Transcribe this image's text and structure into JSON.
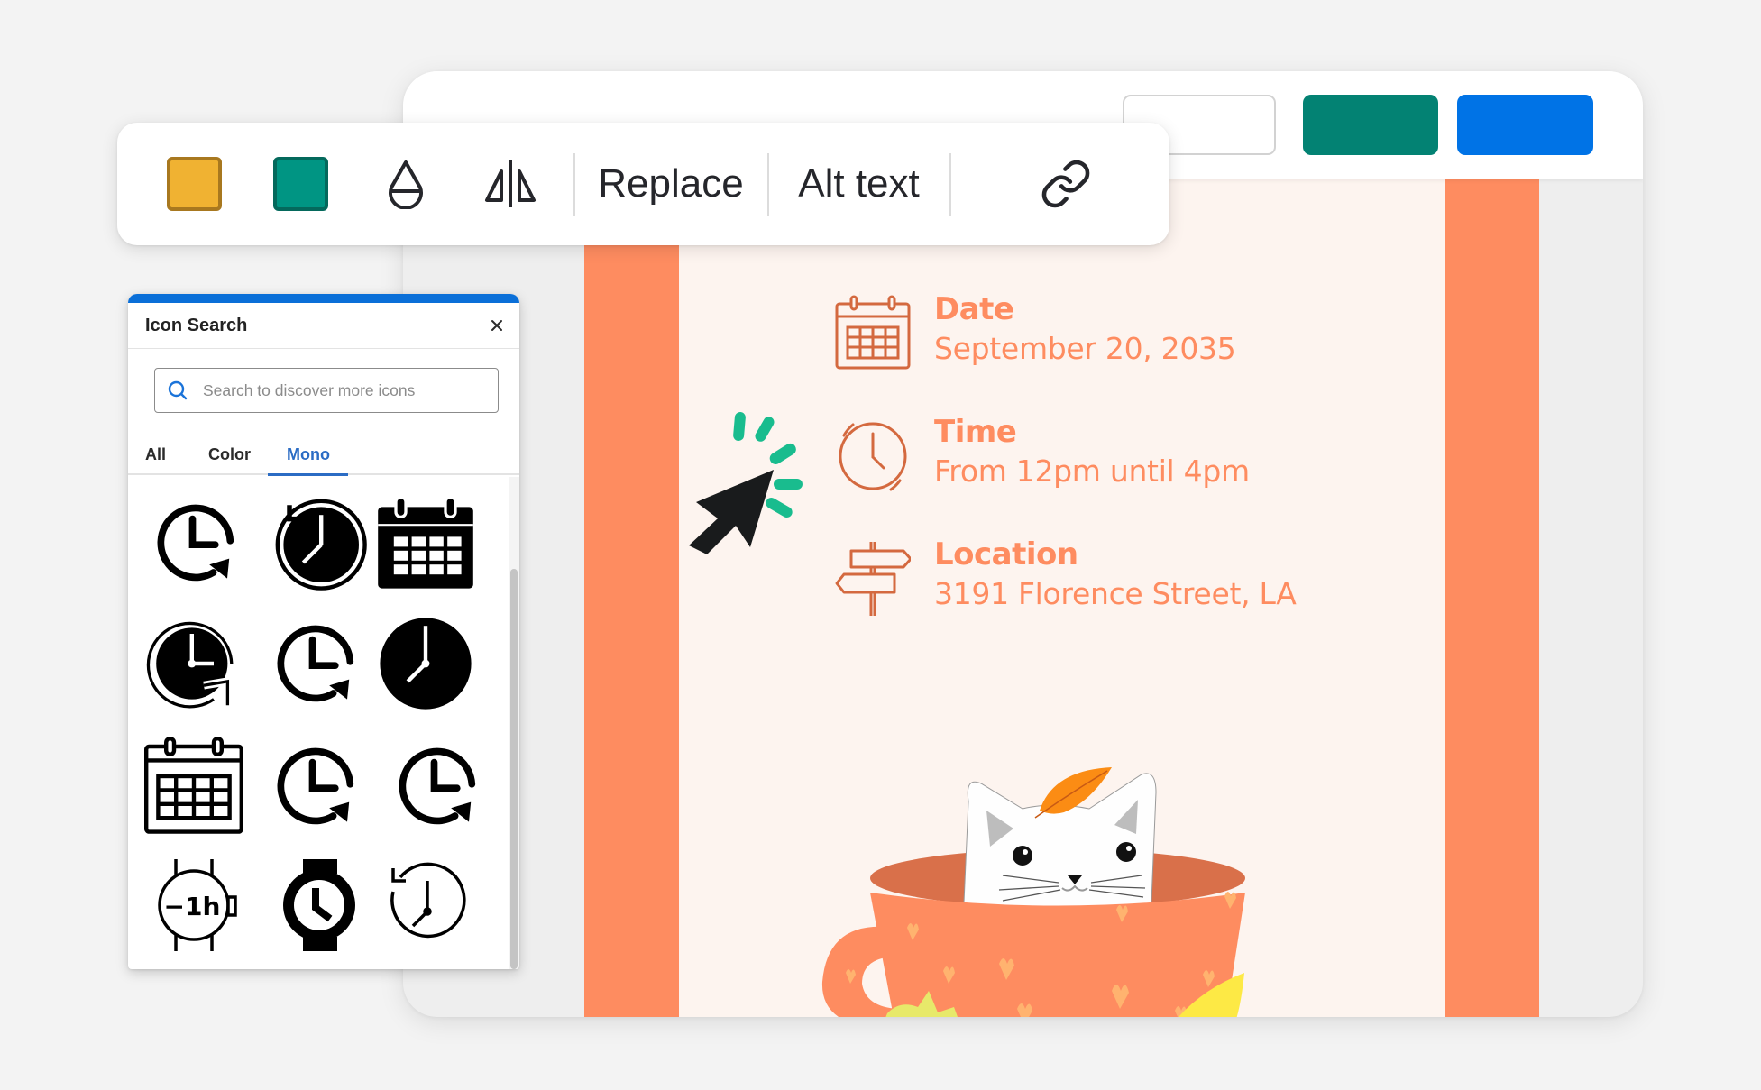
{
  "toolbar": {
    "swatches": [
      {
        "name": "primary-color",
        "color": "#f0b232"
      },
      {
        "name": "secondary-color",
        "color": "#009583"
      }
    ],
    "icons": [
      "opacity-drop-icon",
      "flip-horizontal-icon",
      "link-icon"
    ],
    "replace_label": "Replace",
    "alt_text_label": "Alt text"
  },
  "window_header": {
    "buttons": [
      {
        "name": "outline-button",
        "label": "",
        "color": "#ffffff"
      },
      {
        "name": "teal-button",
        "label": "",
        "color": "#038273"
      },
      {
        "name": "blue-button",
        "label": "",
        "color": "#0073e6"
      }
    ]
  },
  "icon_search": {
    "title": "Icon Search",
    "close_icon": "close-icon",
    "search": {
      "value": "",
      "placeholder": "Search to discover more icons"
    },
    "tabs": [
      {
        "label": "All",
        "active": false
      },
      {
        "label": "Color",
        "active": false
      },
      {
        "label": "Mono",
        "active": true
      }
    ],
    "results": [
      "clock-refresh-icon",
      "clock-history-filled-icon",
      "calendar-filled-icon",
      "clock-refresh-filled-icon",
      "clock-refresh-icon",
      "clock-filled-icon",
      "calendar-outline-icon",
      "clock-refresh-icon",
      "clock-refresh-icon",
      "watch-minus-1h-icon",
      "watch-icon",
      "clock-history-icon"
    ],
    "watch_badge_text": "−1h"
  },
  "poster": {
    "colors": {
      "accent": "#fe8c60",
      "background": "#fdf4ef",
      "icon": "#d4693f"
    },
    "date": {
      "label": "Date",
      "value": "September 20, 2035"
    },
    "time": {
      "label": "Time",
      "value": "From 12pm until 4pm"
    },
    "location": {
      "label": "Location",
      "value": "3191 Florence Street, LA"
    }
  }
}
